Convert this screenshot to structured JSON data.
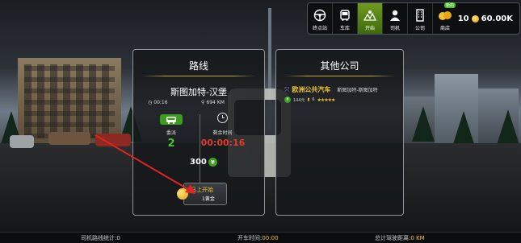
{
  "hud": {
    "buttons": [
      {
        "icon": "steering-wheel-icon",
        "label": "终点站"
      },
      {
        "icon": "bus-icon",
        "label": "车库"
      },
      {
        "icon": "map-icon",
        "label": "开始"
      },
      {
        "icon": "driver-icon",
        "label": "司机"
      },
      {
        "icon": "building-icon",
        "label": "公司"
      },
      {
        "icon": "coins-icon",
        "label": "商店",
        "badge": "新的"
      }
    ],
    "gold": "10",
    "money": "60.00K"
  },
  "route_panel": {
    "title": "路线",
    "route_name": "斯图加特-汉堡",
    "departure_time": "00:16",
    "distance": "694 KM",
    "bus_label": "委派",
    "bus_count": "2",
    "time_label": "剩余时间",
    "time_value": "00:00:16",
    "reward": "300",
    "start_button": {
      "line1": "马上开始",
      "line2": "1黄金"
    }
  },
  "other_panel": {
    "title": "其他公司",
    "company": {
      "name": "欧洲公共汽车",
      "route": "斯图加特-斯图加特",
      "price": "144元",
      "count": "6",
      "stars": "★★★★★"
    }
  },
  "status_bar": {
    "left_label": "司机路线统计:",
    "left_value": "0",
    "mid_label": "开车时间:",
    "mid_value": "00:00",
    "right_label": "总计驾驶距离:",
    "right_value": "0 KM"
  },
  "colors": {
    "accent_gold": "#f2c230",
    "timer_red": "#e03a2a",
    "green": "#3d9b1e"
  }
}
